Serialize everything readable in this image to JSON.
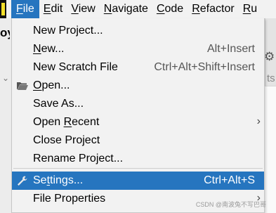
{
  "menubar": {
    "items": [
      {
        "label_pre": "",
        "label_u": "F",
        "label_post": "ile",
        "active": true
      },
      {
        "label_pre": "",
        "label_u": "E",
        "label_post": "dit",
        "active": false
      },
      {
        "label_pre": "",
        "label_u": "V",
        "label_post": "iew",
        "active": false
      },
      {
        "label_pre": "",
        "label_u": "N",
        "label_post": "avigate",
        "active": false
      },
      {
        "label_pre": "",
        "label_u": "C",
        "label_post": "ode",
        "active": false
      },
      {
        "label_pre": "",
        "label_u": "R",
        "label_post": "efactor",
        "active": false
      },
      {
        "label_pre": "",
        "label_u": "R",
        "label_post": "u",
        "active": false
      }
    ]
  },
  "background": {
    "left_text": "oyt",
    "right_text": "ts"
  },
  "file_menu": {
    "items": [
      {
        "label_pre": "New Project...",
        "label_u": "",
        "label_post": "",
        "shortcut": "",
        "submenu": false,
        "icon": ""
      },
      {
        "label_pre": "",
        "label_u": "N",
        "label_post": "ew...",
        "shortcut": "Alt+Insert",
        "submenu": false,
        "icon": ""
      },
      {
        "label_pre": "New Scratch File",
        "label_u": "",
        "label_post": "",
        "shortcut": "Ctrl+Alt+Shift+Insert",
        "submenu": false,
        "icon": ""
      },
      {
        "label_pre": "",
        "label_u": "O",
        "label_post": "pen...",
        "shortcut": "",
        "submenu": false,
        "icon": "folder-open-icon"
      },
      {
        "label_pre": "Save As...",
        "label_u": "",
        "label_post": "",
        "shortcut": "",
        "submenu": false,
        "icon": ""
      },
      {
        "label_pre": "Open ",
        "label_u": "R",
        "label_post": "ecent",
        "shortcut": "",
        "submenu": true,
        "icon": ""
      },
      {
        "label_pre": "Close Project",
        "label_u": "",
        "label_post": "",
        "shortcut": "",
        "submenu": false,
        "icon": ""
      },
      {
        "label_pre": "Rename Project...",
        "label_u": "",
        "label_post": "",
        "shortcut": "",
        "submenu": false,
        "icon": ""
      },
      {
        "label_pre": "Se",
        "label_u": "t",
        "label_post": "tings...",
        "shortcut": "Ctrl+Alt+S",
        "submenu": false,
        "icon": "wrench-icon",
        "selected": true
      },
      {
        "label_pre": "File Properties",
        "label_u": "",
        "label_post": "",
        "shortcut": "",
        "submenu": true,
        "icon": ""
      }
    ]
  },
  "watermark": "CSDN @南波兔不写巴哥",
  "colors": {
    "selection": "#2675bf",
    "menu_bg": "#f2f2f2"
  }
}
